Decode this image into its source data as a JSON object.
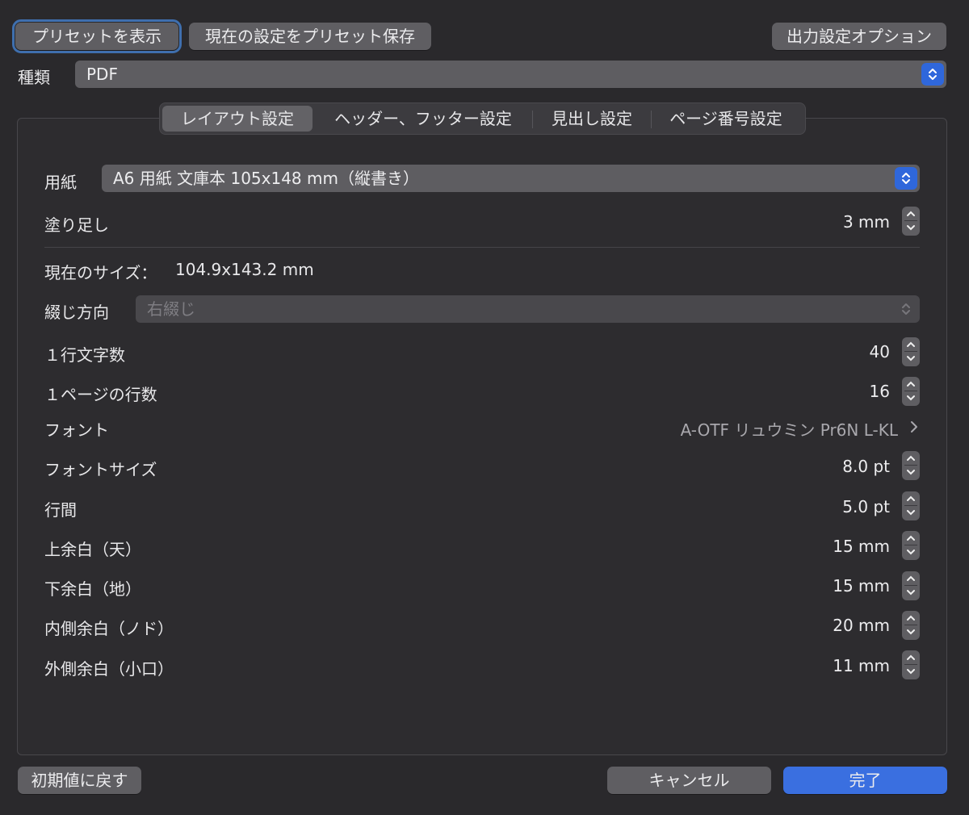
{
  "toolbar": {
    "show_presets": "プリセットを表示",
    "save_preset": "現在の設定をプリセット保存",
    "output_options": "出力設定オプション"
  },
  "kind": {
    "label": "種類",
    "value": "PDF"
  },
  "tabs": [
    {
      "label": "レイアウト設定",
      "active": true
    },
    {
      "label": "ヘッダー、フッター設定",
      "active": false
    },
    {
      "label": "見出し設定",
      "active": false
    },
    {
      "label": "ページ番号設定",
      "active": false
    }
  ],
  "paper": {
    "label": "用紙",
    "value": "A6 用紙 文庫本 105x148 mm（縦書き）"
  },
  "bleed": {
    "label": "塗り足し",
    "value": "3 mm"
  },
  "current_size": {
    "label": "現在のサイズ：",
    "value": "104.9x143.2 mm"
  },
  "binding": {
    "label": "綴じ方向",
    "value": "右綴じ"
  },
  "chars_per_line": {
    "label": "１行文字数",
    "value": "40"
  },
  "lines_per_page": {
    "label": "１ページの行数",
    "value": "16"
  },
  "font": {
    "label": "フォント",
    "value": "A-OTF リュウミン Pr6N L-KL",
    "icon": "chevron-right-icon"
  },
  "font_size": {
    "label": "フォントサイズ",
    "value": "8.0 pt"
  },
  "line_spacing": {
    "label": "行間",
    "value": "5.0 pt"
  },
  "margin_top": {
    "label": "上余白（天）",
    "value": "15 mm"
  },
  "margin_bottom": {
    "label": "下余白（地）",
    "value": "15 mm"
  },
  "margin_inner": {
    "label": "内側余白（ノド）",
    "value": "20 mm"
  },
  "margin_outer": {
    "label": "外側余白（小口）",
    "value": "11 mm"
  },
  "footer": {
    "reset": "初期値に戻す",
    "cancel": "キャンセル",
    "done": "完了"
  },
  "colors": {
    "background": "#2a292c",
    "accent": "#3a6fe0",
    "control": "#5f5e62"
  }
}
